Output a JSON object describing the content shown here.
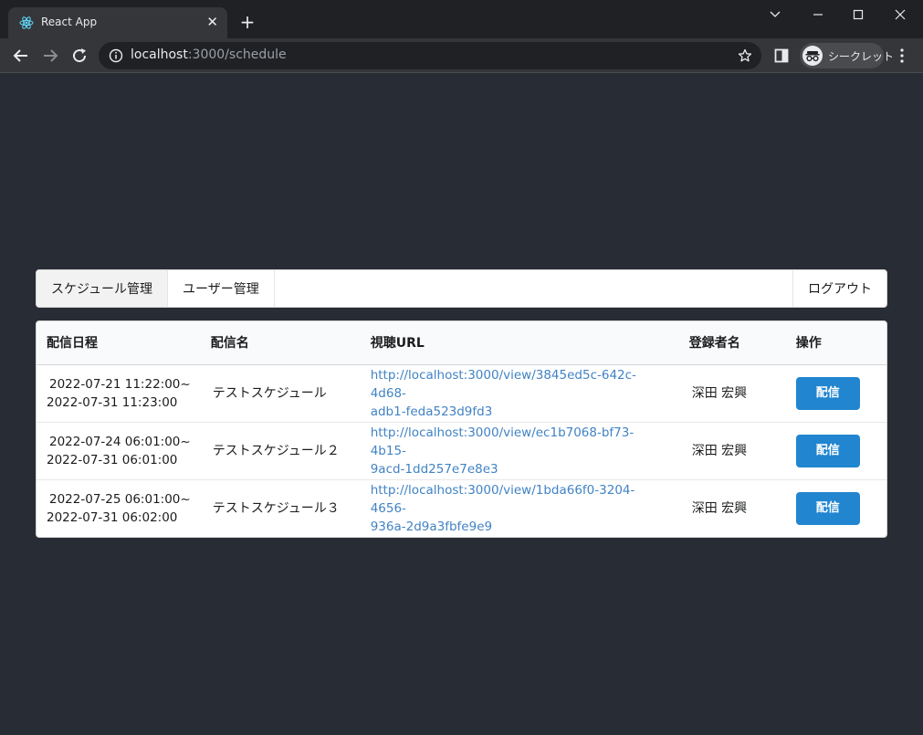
{
  "browser": {
    "tab_title": "React App",
    "url_host": "localhost",
    "url_rest": ":3000/schedule",
    "incognito_label": "シークレット"
  },
  "nav": {
    "schedule": "スケジュール管理",
    "users": "ユーザー管理",
    "logout": "ログアウト"
  },
  "table": {
    "headers": [
      "配信日程",
      "配信名",
      "視聴URL",
      "登録者名",
      "操作"
    ],
    "rows": [
      {
        "start": "2022-07-21 11:22:00~",
        "end": "2022-07-31 11:23:00",
        "name": "テストスケジュール",
        "url1": "http://localhost:3000/view/3845ed5c-642c-4d68-",
        "url2": "adb1-feda523d9fd3",
        "registrant": "深田 宏興",
        "action": "配信"
      },
      {
        "start": "2022-07-24 06:01:00~",
        "end": "2022-07-31 06:01:00",
        "name": "テストスケジュール２",
        "url1": "http://localhost:3000/view/ec1b7068-bf73-4b15-",
        "url2": "9acd-1dd257e7e8e3",
        "registrant": "深田 宏興",
        "action": "配信"
      },
      {
        "start": "2022-07-25 06:01:00~",
        "end": "2022-07-31 06:02:00",
        "name": "テストスケジュール３",
        "url1": "http://localhost:3000/view/1bda66f0-3204-4656-",
        "url2": "936a-2d9a3fbfe9e9",
        "registrant": "深田 宏興",
        "action": "配信"
      }
    ]
  },
  "colors": {
    "page_bg": "#282c34",
    "primary_button": "#2185d0",
    "link": "#4183c4"
  }
}
